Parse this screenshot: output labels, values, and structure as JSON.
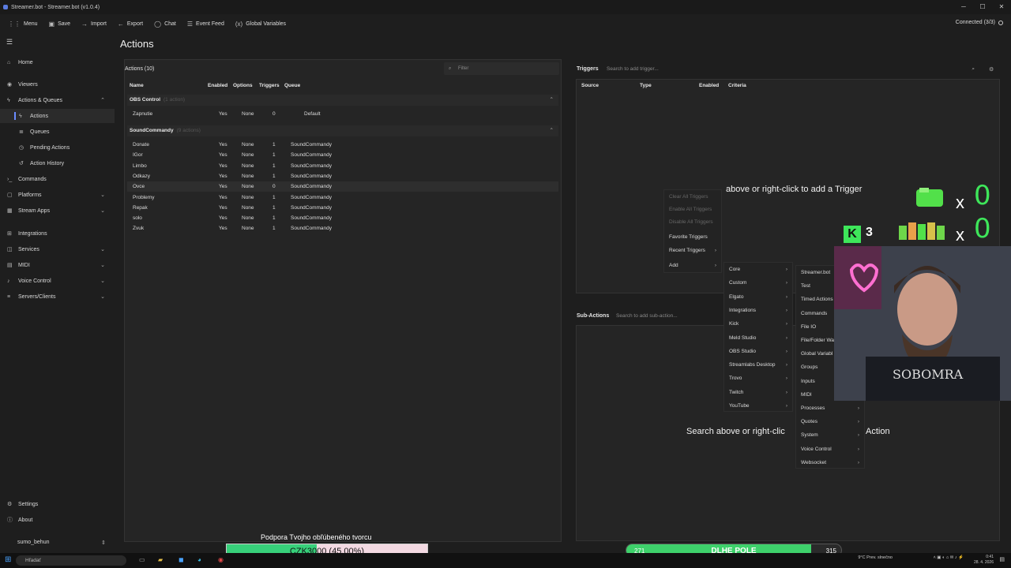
{
  "window": {
    "title": "Streamer.bot - Streamer.bot (v1.0.4)"
  },
  "toolbar": {
    "items": [
      {
        "label": "Menu",
        "icon": "grid-icon"
      },
      {
        "label": "Save",
        "icon": "save-icon"
      },
      {
        "label": "Import",
        "icon": "import-icon"
      },
      {
        "label": "Export",
        "icon": "export-icon"
      },
      {
        "label": "Chat",
        "icon": "chat-icon"
      },
      {
        "label": "Event Feed",
        "icon": "list-icon"
      },
      {
        "label": "Global Variables",
        "icon": "variables-icon"
      }
    ],
    "connection_status": "Connected (3/3)"
  },
  "sidebar": {
    "items": [
      {
        "label": "Home"
      },
      {
        "label": "Viewers"
      },
      {
        "label": "Actions & Queues"
      },
      {
        "label": "Actions"
      },
      {
        "label": "Queues"
      },
      {
        "label": "Pending Actions"
      },
      {
        "label": "Action History"
      },
      {
        "label": "Commands"
      },
      {
        "label": "Platforms"
      },
      {
        "label": "Stream Apps"
      },
      {
        "label": "Integrations"
      },
      {
        "label": "Services"
      },
      {
        "label": "MIDI"
      },
      {
        "label": "Voice Control"
      },
      {
        "label": "Servers/Clients"
      },
      {
        "label": "Settings"
      },
      {
        "label": "About"
      }
    ],
    "user": "sumo_behun"
  },
  "page": {
    "title": "Actions"
  },
  "actions_panel": {
    "header": "Actions (10)",
    "filter_placeholder": "Filter",
    "columns": [
      "Name",
      "Enabled",
      "Options",
      "Triggers",
      "Queue"
    ],
    "groups": [
      {
        "name": "OBS Control",
        "count": "(1 action)",
        "rows": [
          {
            "name": "Zapnutie",
            "enabled": "Yes",
            "options": "None",
            "triggers": "0",
            "queue": "Default"
          }
        ]
      },
      {
        "name": "SoundCommandy",
        "count": "(9 actions)",
        "rows": [
          {
            "name": "Donate",
            "enabled": "Yes",
            "options": "None",
            "triggers": "1",
            "queue": "SoundCommandy"
          },
          {
            "name": "IGor",
            "enabled": "Yes",
            "options": "None",
            "triggers": "1",
            "queue": "SoundCommandy"
          },
          {
            "name": "Limbo",
            "enabled": "Yes",
            "options": "None",
            "triggers": "1",
            "queue": "SoundCommandy"
          },
          {
            "name": "Odkazy",
            "enabled": "Yes",
            "options": "None",
            "triggers": "1",
            "queue": "SoundCommandy"
          },
          {
            "name": "Ovce",
            "enabled": "Yes",
            "options": "None",
            "triggers": "0",
            "queue": "SoundCommandy"
          },
          {
            "name": "Problemy",
            "enabled": "Yes",
            "options": "None",
            "triggers": "1",
            "queue": "SoundCommandy"
          },
          {
            "name": "Repak",
            "enabled": "Yes",
            "options": "None",
            "triggers": "1",
            "queue": "SoundCommandy"
          },
          {
            "name": "solo",
            "enabled": "Yes",
            "options": "None",
            "triggers": "1",
            "queue": "SoundCommandy"
          },
          {
            "name": "Zvuk",
            "enabled": "Yes",
            "options": "None",
            "triggers": "1",
            "queue": "SoundCommandy"
          }
        ]
      }
    ]
  },
  "triggers_panel": {
    "header": "Triggers",
    "search_placeholder": "Search to add trigger...",
    "columns": [
      "Source",
      "Type",
      "Enabled",
      "Criteria"
    ],
    "empty_text": "above or right-click to add a Trigger"
  },
  "subactions_panel": {
    "header": "Sub-Actions",
    "search_placeholder": "Search to add sub-action...",
    "empty_text": "Search above or right-clic",
    "empty_text_tail": "Action"
  },
  "context_menu": {
    "items": [
      {
        "label": "Clear All Triggers",
        "disabled": true
      },
      {
        "label": "Enable All Triggers",
        "disabled": true
      },
      {
        "label": "Disable All Triggers",
        "disabled": true
      },
      {
        "label": "Favorite Triggers",
        "disabled": false
      },
      {
        "label": "Recent Triggers",
        "disabled": false,
        "submenu": true
      },
      {
        "label": "Add",
        "disabled": false,
        "submenu": true
      }
    ]
  },
  "add_submenu": {
    "items": [
      "Core",
      "Custom",
      "Elgato",
      "Integrations",
      "Kick",
      "Meld Studio",
      "OBS Studio",
      "Streamlabs Desktop",
      "Trovo",
      "Twitch",
      "YouTube"
    ]
  },
  "core_submenu": {
    "items": [
      "Streamer.bot",
      "Test",
      "Timed Actions",
      "Commands",
      "File IO",
      "File/Folder Wa",
      "Global Variabl",
      "Groups",
      "Inputs",
      "MIDI",
      "Processes",
      "Quotes",
      "System",
      "Voice Control",
      "Websocket"
    ]
  },
  "overlay": {
    "support_text": "Podpora Tvojho obľúbeného tvorcu",
    "goal_text": "CZK3000 (45.00%)",
    "goal_progress": 0.45,
    "pole_text": "DLHE POLE",
    "pole_left": "271",
    "pole_right": "315",
    "pole_progress": 0.86,
    "counter_a": "0",
    "counter_b": "0",
    "k_count": "3",
    "x_label": "x"
  },
  "taskbar": {
    "search_placeholder": "Hľadať",
    "weather": "9°C Prev. slnečno",
    "time": "0:41",
    "date": "28. 4. 2026"
  },
  "colors": {
    "accent": "#6b8cff",
    "green": "#3ed16b",
    "goal_bg": "#f3d9e2"
  }
}
